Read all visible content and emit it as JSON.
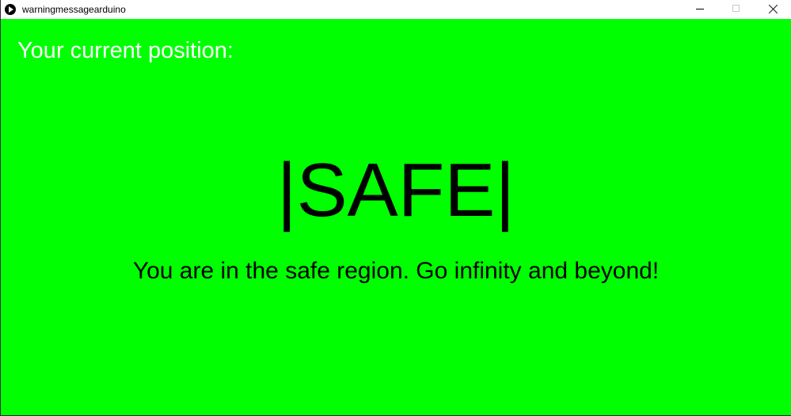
{
  "window": {
    "title": "warningmessagearduino",
    "app_icon": "play-icon",
    "controls": {
      "minimize_icon": "minimize-icon",
      "maximize_icon": "maximize-icon",
      "close_icon": "close-icon"
    }
  },
  "canvas": {
    "background_color": "#00ff00",
    "position_label": "Your current position:",
    "position_label_color": "#ffffff",
    "status": "|SAFE|",
    "message": "You are in the safe region. Go infinity and beyond!",
    "text_color": "#000000"
  }
}
